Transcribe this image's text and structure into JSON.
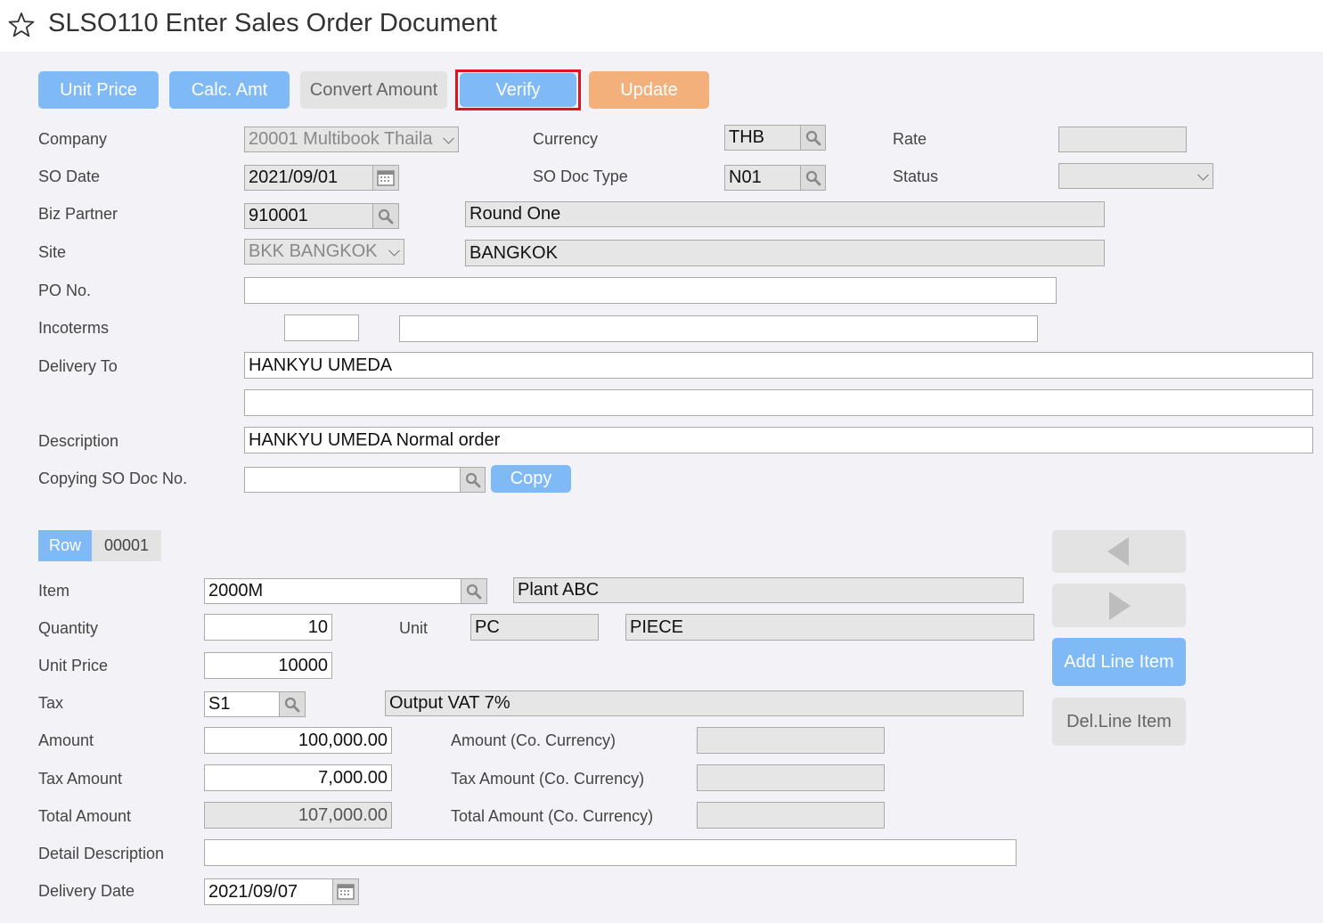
{
  "header": {
    "title": "SLSO110 Enter Sales Order Document"
  },
  "toolbar": {
    "unit_price": "Unit Price",
    "calc_amt": "Calc. Amt",
    "convert_amount": "Convert Amount",
    "verify": "Verify",
    "update": "Update"
  },
  "form": {
    "company_label": "Company",
    "company_value": "20001 Multibook Thaila",
    "currency_label": "Currency",
    "currency_value": "THB",
    "rate_label": "Rate",
    "rate_value": "",
    "so_date_label": "SO Date",
    "so_date_value": "2021/09/01",
    "so_doc_type_label": "SO Doc Type",
    "so_doc_type_value": "N01",
    "status_label": "Status",
    "status_value": "",
    "biz_partner_label": "Biz Partner",
    "biz_partner_code": "910001",
    "biz_partner_name": "Round One",
    "site_label": "Site",
    "site_value": "BKK BANGKOK",
    "site_name": "BANGKOK",
    "po_no_label": "PO No.",
    "po_no_value": "",
    "incoterms_label": "Incoterms",
    "incoterms_code": "",
    "incoterms_desc": "",
    "delivery_to_label": "Delivery To",
    "delivery_to_1": "HANKYU UMEDA",
    "delivery_to_2": "",
    "description_label": "Description",
    "description_value": "HANKYU UMEDA Normal order",
    "copying_label": "Copying SO Doc No.",
    "copying_value": "",
    "copy_button": "Copy"
  },
  "line": {
    "row_label": "Row",
    "row_number": "00001",
    "item_label": "Item",
    "item_code": "2000M",
    "item_name": "Plant ABC",
    "quantity_label": "Quantity",
    "quantity_value": "10",
    "unit_label": "Unit",
    "unit_code": "PC",
    "unit_name": "PIECE",
    "unit_price_label": "Unit Price",
    "unit_price_value": "10000",
    "tax_label": "Tax",
    "tax_code": "S1",
    "tax_name": "Output VAT 7%",
    "amount_label": "Amount",
    "amount_value": "100,000.00",
    "amount_co_label": "Amount (Co. Currency)",
    "amount_co_value": "",
    "tax_amount_label": "Tax Amount",
    "tax_amount_value": "7,000.00",
    "tax_amount_co_label": "Tax Amount (Co. Currency)",
    "tax_amount_co_value": "",
    "total_amount_label": "Total Amount",
    "total_amount_value": "107,000.00",
    "total_amount_co_label": "Total Amount (Co. Currency)",
    "total_amount_co_value": "",
    "detail_desc_label": "Detail Description",
    "detail_desc_value": "",
    "delivery_date_label": "Delivery Date",
    "delivery_date_value": "2021/09/07"
  },
  "side": {
    "add_line": "Add Line Item",
    "del_line": "Del.Line Item"
  },
  "colors": {
    "primary": "#7fbaf7",
    "update": "#f3b07a",
    "highlight": "#e0141e"
  }
}
